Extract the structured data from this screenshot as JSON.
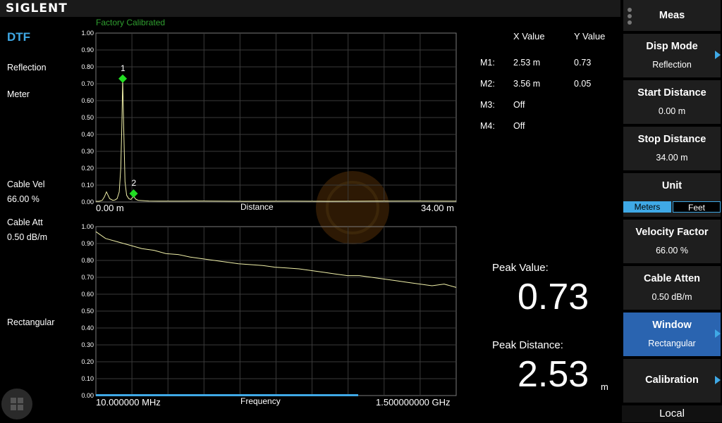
{
  "header": {
    "brand": "SIGLENT",
    "calibration_status": "Factory Calibrated"
  },
  "left_panel": {
    "mode": "DTF",
    "disp_mode": "Reflection",
    "format": "Meter",
    "cable_vel_label": "Cable Vel",
    "cable_vel_value": "66.00 %",
    "cable_att_label": "Cable Att",
    "cable_att_value": "0.50 dB/m",
    "window": "Rectangular"
  },
  "chart_data": [
    {
      "type": "line",
      "xlabel": "Distance",
      "x_start_label": "0.00 m",
      "x_stop_label": "34.00 m",
      "xlim": [
        0,
        34
      ],
      "ylim": [
        0,
        1
      ],
      "y_ticks": [
        "1.00",
        "0.90",
        "0.80",
        "0.70",
        "0.60",
        "0.50",
        "0.40",
        "0.30",
        "0.20",
        "0.10",
        "0.00"
      ],
      "grid": true,
      "series": [
        {
          "x": [
            0,
            0.3,
            0.6,
            0.8,
            1.0,
            1.3,
            1.6,
            1.8,
            2.0,
            2.2,
            2.35,
            2.45,
            2.53,
            2.62,
            2.75,
            2.9,
            3.1,
            3.3,
            3.5,
            3.56,
            3.65,
            3.8,
            4.0,
            4.5,
            5,
            6,
            8,
            10,
            14,
            18,
            22,
            26,
            30,
            34
          ],
          "y": [
            0.004,
            0.004,
            0.01,
            0.03,
            0.06,
            0.02,
            0.01,
            0.012,
            0.02,
            0.06,
            0.2,
            0.45,
            0.73,
            0.45,
            0.12,
            0.04,
            0.02,
            0.015,
            0.03,
            0.05,
            0.025,
            0.015,
            0.01,
            0.008,
            0.006,
            0.005,
            0.005,
            0.006,
            0.004,
            0.005,
            0.004,
            0.005,
            0.006,
            0.005
          ]
        }
      ],
      "markers": [
        {
          "label": "1",
          "x": 2.53,
          "y": 0.73
        },
        {
          "label": "2",
          "x": 3.56,
          "y": 0.05
        }
      ]
    },
    {
      "type": "line",
      "xlabel": "Frequency",
      "x_start_label": "10.000000 MHz",
      "x_stop_label": "1.500000000 GHz",
      "xlim": [
        0.01,
        1.5
      ],
      "ylim": [
        0,
        1
      ],
      "y_ticks": [
        "1.00",
        "0.90",
        "0.80",
        "0.70",
        "0.60",
        "0.50",
        "0.40",
        "0.30",
        "0.20",
        "0.10",
        "0.00"
      ],
      "grid": true,
      "series": [
        {
          "x": [
            0.01,
            0.05,
            0.1,
            0.15,
            0.2,
            0.25,
            0.3,
            0.35,
            0.4,
            0.45,
            0.5,
            0.55,
            0.6,
            0.65,
            0.7,
            0.75,
            0.8,
            0.85,
            0.9,
            0.95,
            1.0,
            1.05,
            1.1,
            1.15,
            1.2,
            1.25,
            1.3,
            1.35,
            1.4,
            1.45,
            1.5
          ],
          "y": [
            0.97,
            0.93,
            0.91,
            0.89,
            0.87,
            0.86,
            0.84,
            0.835,
            0.82,
            0.81,
            0.8,
            0.79,
            0.78,
            0.775,
            0.77,
            0.76,
            0.755,
            0.75,
            0.74,
            0.73,
            0.72,
            0.71,
            0.71,
            0.7,
            0.69,
            0.68,
            0.67,
            0.66,
            0.65,
            0.66,
            0.64
          ]
        }
      ]
    }
  ],
  "markers_table": {
    "header_x": "X  Value",
    "header_y": "Y  Value",
    "rows": [
      {
        "name": "M1:",
        "x": "2.53 m",
        "y": "0.73"
      },
      {
        "name": "M2:",
        "x": "3.56 m",
        "y": "0.05"
      },
      {
        "name": "M3:",
        "x": "Off",
        "y": ""
      },
      {
        "name": "M4:",
        "x": "Off",
        "y": ""
      }
    ]
  },
  "peak": {
    "value_label": "Peak Value:",
    "value": "0.73",
    "distance_label": "Peak Distance:",
    "distance": "2.53",
    "distance_unit": "m"
  },
  "softkeys": {
    "menu_title": "Meas",
    "disp_mode": {
      "title": "Disp Mode",
      "value": "Reflection"
    },
    "start_distance": {
      "title": "Start Distance",
      "value": "0.00 m"
    },
    "stop_distance": {
      "title": "Stop Distance",
      "value": "34.00 m"
    },
    "unit": {
      "title": "Unit",
      "opt1": "Meters",
      "opt2": "Feet"
    },
    "velocity_factor": {
      "title": "Velocity Factor",
      "value": "66.00 %"
    },
    "cable_atten": {
      "title": "Cable Atten",
      "value": "0.50 dB/m"
    },
    "window": {
      "title": "Window",
      "value": "Rectangular"
    },
    "calibration": {
      "title": "Calibration"
    },
    "local": "Local"
  },
  "colors": {
    "trace": "#f0f0a8",
    "marker": "#22dd22",
    "accent": "#3fa9e6",
    "active": "#2a64b0"
  }
}
